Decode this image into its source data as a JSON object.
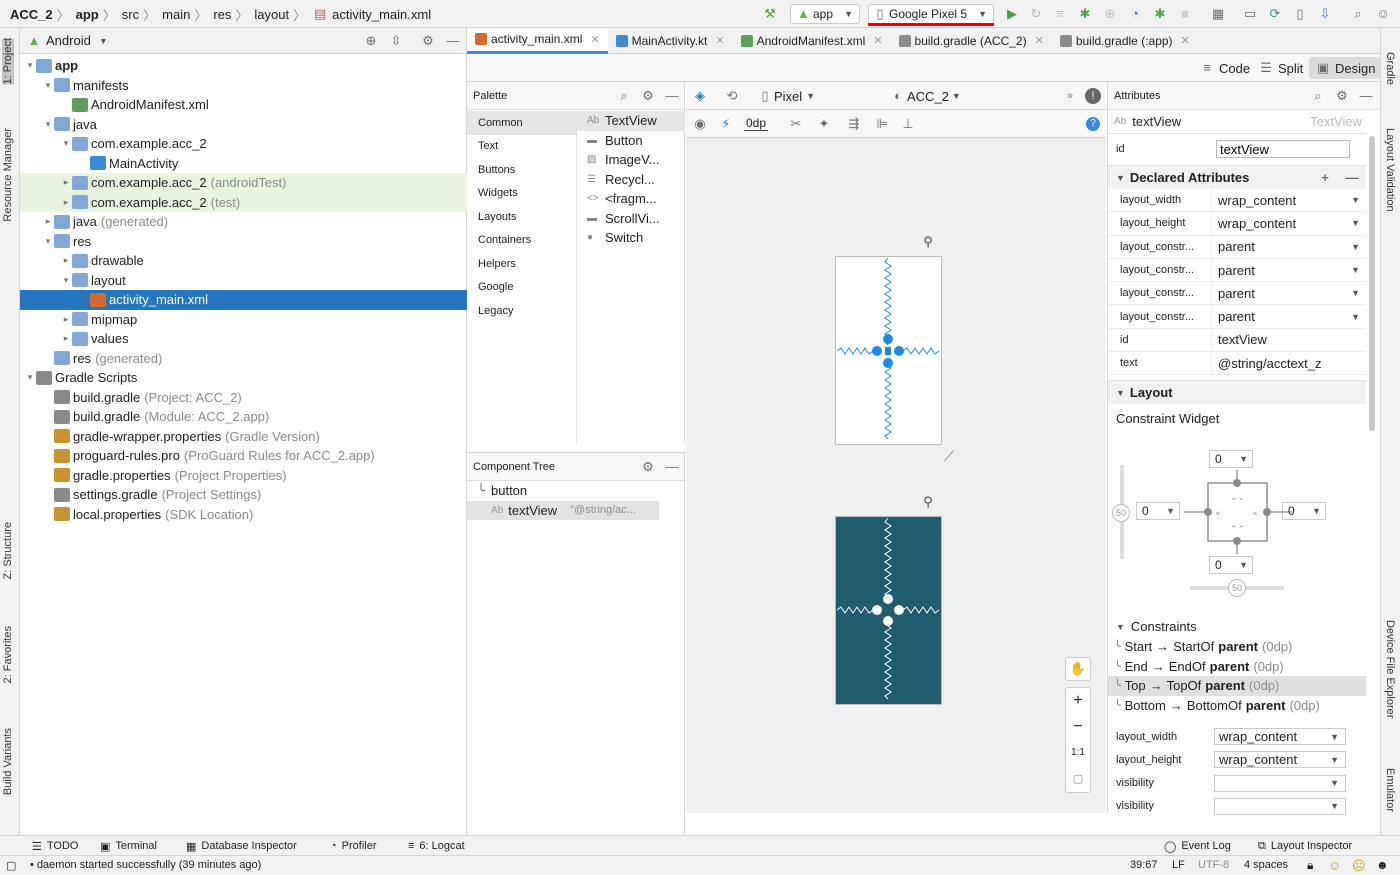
{
  "breadcrumb": [
    "ACC_2",
    "app",
    "src",
    "main",
    "res",
    "layout",
    "activity_main.xml"
  ],
  "toolbar": {
    "run_config": "app",
    "device": "Google Pixel 5"
  },
  "left_strip": [
    "1: Project",
    "Resource Manager",
    "Z: Structure",
    "2: Favorites",
    "Build Variants"
  ],
  "right_strip": [
    "Gradle",
    "Layout Validation",
    "Device File Explorer",
    "Emulator"
  ],
  "project": {
    "view_mode": "Android",
    "tree": [
      {
        "label": "app",
        "extra": "",
        "indent": 0,
        "arrow": "▾",
        "icon": "folder",
        "bold": true
      },
      {
        "label": "manifests",
        "extra": "",
        "indent": 1,
        "arrow": "▾",
        "icon": "folder"
      },
      {
        "label": "AndroidManifest.xml",
        "extra": "",
        "indent": 2,
        "arrow": "",
        "icon": "manifest"
      },
      {
        "label": "java",
        "extra": "",
        "indent": 1,
        "arrow": "▾",
        "icon": "folder"
      },
      {
        "label": "com.example.acc_2",
        "extra": "",
        "indent": 2,
        "arrow": "▾",
        "icon": "package"
      },
      {
        "label": "MainActivity",
        "extra": "",
        "indent": 3,
        "arrow": "",
        "icon": "kotlin"
      },
      {
        "label": "com.example.acc_2",
        "extra": "(androidTest)",
        "indent": 2,
        "arrow": "▸",
        "icon": "package",
        "test": true
      },
      {
        "label": "com.example.acc_2",
        "extra": "(test)",
        "indent": 2,
        "arrow": "▸",
        "icon": "package",
        "test": true
      },
      {
        "label": "java",
        "extra": "(generated)",
        "indent": 1,
        "arrow": "▸",
        "icon": "folder"
      },
      {
        "label": "res",
        "extra": "",
        "indent": 1,
        "arrow": "▾",
        "icon": "folder"
      },
      {
        "label": "drawable",
        "extra": "",
        "indent": 2,
        "arrow": "▸",
        "icon": "folder"
      },
      {
        "label": "layout",
        "extra": "",
        "indent": 2,
        "arrow": "▾",
        "icon": "folder"
      },
      {
        "label": "activity_main.xml",
        "extra": "",
        "indent": 3,
        "arrow": "",
        "icon": "xml",
        "selected": true
      },
      {
        "label": "mipmap",
        "extra": "",
        "indent": 2,
        "arrow": "▸",
        "icon": "folder"
      },
      {
        "label": "values",
        "extra": "",
        "indent": 2,
        "arrow": "▸",
        "icon": "folder"
      },
      {
        "label": "res",
        "extra": "(generated)",
        "indent": 1,
        "arrow": "",
        "icon": "folder"
      },
      {
        "label": "Gradle Scripts",
        "extra": "",
        "indent": 0,
        "arrow": "▾",
        "icon": "gradle"
      },
      {
        "label": "build.gradle",
        "extra": "(Project: ACC_2)",
        "indent": 1,
        "arrow": "",
        "icon": "gradle"
      },
      {
        "label": "build.gradle",
        "extra": "(Module: ACC_2.app)",
        "indent": 1,
        "arrow": "",
        "icon": "gradle"
      },
      {
        "label": "gradle-wrapper.properties",
        "extra": "(Gradle Version)",
        "indent": 1,
        "arrow": "",
        "icon": "props"
      },
      {
        "label": "proguard-rules.pro",
        "extra": "(ProGuard Rules for ACC_2.app)",
        "indent": 1,
        "arrow": "",
        "icon": "props"
      },
      {
        "label": "gradle.properties",
        "extra": "(Project Properties)",
        "indent": 1,
        "arrow": "",
        "icon": "props"
      },
      {
        "label": "settings.gradle",
        "extra": "(Project Settings)",
        "indent": 1,
        "arrow": "",
        "icon": "gradle"
      },
      {
        "label": "local.properties",
        "extra": "(SDK Location)",
        "indent": 1,
        "arrow": "",
        "icon": "props"
      }
    ]
  },
  "editor_tabs": [
    {
      "label": "activity_main.xml",
      "active": true
    },
    {
      "label": "MainActivity.kt",
      "active": false
    },
    {
      "label": "AndroidManifest.xml",
      "active": false
    },
    {
      "label": "build.gradle (ACC_2)",
      "active": false
    },
    {
      "label": "build.gradle (:app)",
      "active": false
    }
  ],
  "view_modes": {
    "code": "Code",
    "split": "Split",
    "design": "Design"
  },
  "palette": {
    "title": "Palette",
    "categories": [
      "Common",
      "Text",
      "Buttons",
      "Widgets",
      "Layouts",
      "Containers",
      "Helpers",
      "Google",
      "Legacy"
    ],
    "items": [
      "TextView",
      "Button",
      "ImageV...",
      "Recycl...",
      "<fragm...",
      "ScrollVi...",
      "Switch"
    ]
  },
  "component_tree": {
    "title": "Component Tree",
    "items": [
      {
        "label": "button",
        "hint": ""
      },
      {
        "label": "textView",
        "hint": "\"@string/ac..."
      }
    ]
  },
  "design_toolbar": {
    "device": "Pixel",
    "theme": "ACC_2",
    "margin": "0dp"
  },
  "zoom": {
    "fit": "1:1"
  },
  "attributes": {
    "title": "Attributes",
    "widget_name": "textView",
    "widget_type": "TextView",
    "id_label": "id",
    "id_value": "textView",
    "declared_title": "Declared Attributes",
    "declared": [
      {
        "name": "layout_width",
        "value": "wrap_content",
        "dd": true
      },
      {
        "name": "layout_height",
        "value": "wrap_content",
        "dd": true
      },
      {
        "name": "layout_constr...",
        "value": "parent",
        "dd": true
      },
      {
        "name": "layout_constr...",
        "value": "parent",
        "dd": true
      },
      {
        "name": "layout_constr...",
        "value": "parent",
        "dd": true
      },
      {
        "name": "layout_constr...",
        "value": "parent",
        "dd": true
      },
      {
        "name": "id",
        "value": "textView",
        "dd": false
      },
      {
        "name": "text",
        "value": "@string/acctext_z",
        "dd": false
      }
    ],
    "layout_title": "Layout",
    "constraint_widget_label": "Constraint Widget",
    "margins": {
      "top": "0",
      "left": "0",
      "right": "0",
      "bottom": "0"
    },
    "bias": {
      "vertical": "50",
      "horizontal": "50"
    },
    "constraints_title": "Constraints",
    "constraints": [
      {
        "side": "Start",
        "target": "StartOf",
        "parent": "parent",
        "dp": "(0dp)"
      },
      {
        "side": "End",
        "target": "EndOf",
        "parent": "parent",
        "dp": "(0dp)"
      },
      {
        "side": "Top",
        "target": "TopOf",
        "parent": "parent",
        "dp": "(0dp)",
        "selected": true
      },
      {
        "side": "Bottom",
        "target": "BottomOf",
        "parent": "parent",
        "dp": "(0dp)"
      }
    ],
    "layout_rows": [
      {
        "name": "layout_width",
        "value": "wrap_content"
      },
      {
        "name": "layout_height",
        "value": "wrap_content"
      },
      {
        "name": "visibility",
        "value": ""
      },
      {
        "name": "visibility",
        "value": ""
      }
    ]
  },
  "bottom_tabs": {
    "left": [
      "TODO",
      "Terminal",
      "Database Inspector",
      "Profiler",
      "6: Logcat"
    ],
    "right": [
      "Event Log",
      "Layout Inspector"
    ]
  },
  "status": {
    "message": "daemon started successfully (39 minutes ago)",
    "position": "39:67",
    "line_sep": "LF",
    "encoding": "UTF-8",
    "indent": "4 spaces"
  },
  "colors": {
    "accent": "#2675bf",
    "blueprint": "#1f5d6e",
    "constraint": "#1e88e5",
    "annotation_red": "#ff0000"
  }
}
